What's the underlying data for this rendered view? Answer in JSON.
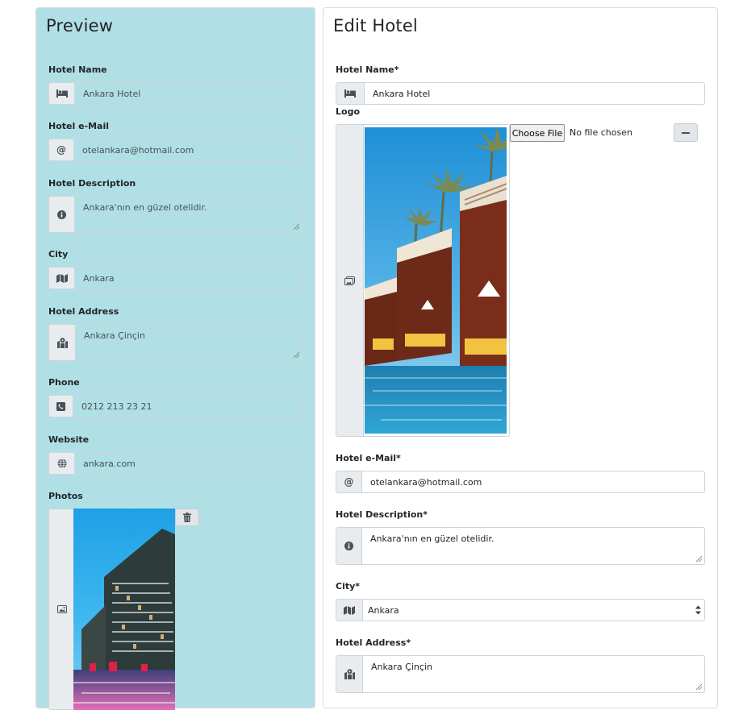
{
  "preview": {
    "title": "Preview",
    "fields": {
      "name": {
        "label": "Hotel Name",
        "value": "Ankara Hotel",
        "icon": "bed-icon"
      },
      "email": {
        "label": "Hotel e-Mail",
        "value": "otelankara@hotmail.com",
        "icon": "at-icon"
      },
      "description": {
        "label": "Hotel Description",
        "value": "Ankara'nın en güzel otelidir.",
        "icon": "info-icon"
      },
      "city": {
        "label": "City",
        "value": "Ankara",
        "icon": "map-icon"
      },
      "address": {
        "label": "Hotel Address",
        "value": "Ankara Çinçin",
        "icon": "map-marker-icon"
      },
      "phone": {
        "label": "Phone",
        "value": "0212 213 23 21",
        "icon": "phone-icon"
      },
      "website": {
        "label": "Website",
        "value": "ankara.com",
        "icon": "globe-icon"
      },
      "photos": {
        "label": "Photos",
        "icon": "image-icon",
        "delete_icon": "trash-icon"
      }
    }
  },
  "edit": {
    "title": "Edit Hotel",
    "fields": {
      "name": {
        "label": "Hotel Name*",
        "value": "Ankara Hotel",
        "icon": "bed-icon"
      },
      "logo": {
        "label": "Logo",
        "choose_file": "Choose File",
        "no_file": "No file chosen",
        "icon": "images-icon",
        "remove_icon": "minus-icon"
      },
      "email": {
        "label": "Hotel e-Mail*",
        "value": "otelankara@hotmail.com",
        "icon": "at-icon"
      },
      "description": {
        "label": "Hotel Description*",
        "value": "Ankara'nın en güzel otelidir.",
        "icon": "info-icon"
      },
      "city": {
        "label": "City*",
        "value": "Ankara",
        "icon": "map-icon"
      },
      "address": {
        "label": "Hotel Address*",
        "value": "Ankara Çinçin",
        "icon": "map-marker-icon"
      }
    }
  },
  "colors": {
    "preview_bg": "#b0e0e6",
    "addon_bg": "#e9ecef",
    "border": "#ced4da"
  }
}
